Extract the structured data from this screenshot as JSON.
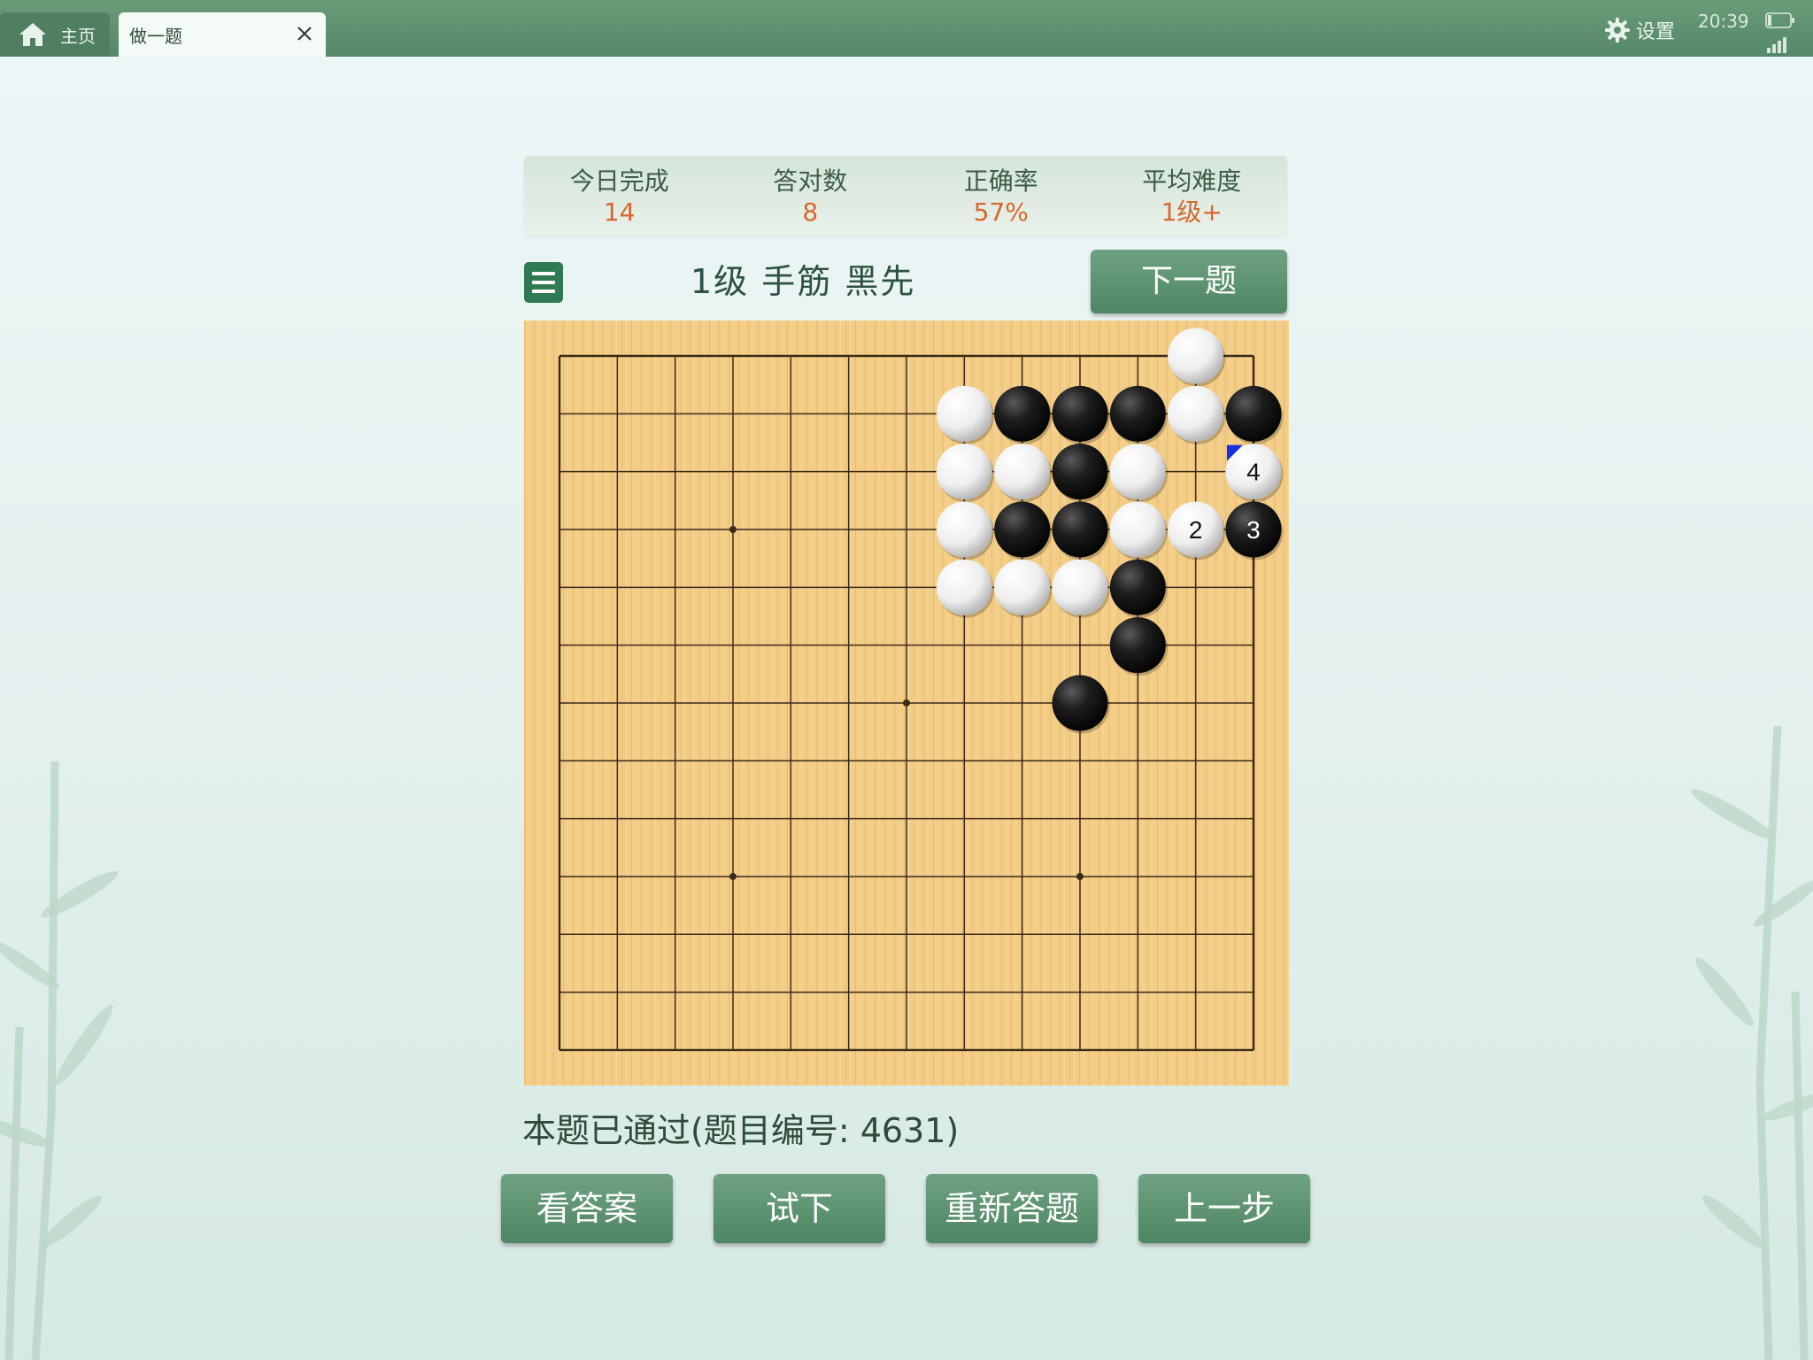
{
  "tabs": {
    "home_label": "主页",
    "active_label": "做一题"
  },
  "statusbar": {
    "settings_label": "设置",
    "time": "20:39"
  },
  "stats": [
    {
      "label": "今日完成",
      "value": "14"
    },
    {
      "label": "答对数",
      "value": "8"
    },
    {
      "label": "正确率",
      "value": "57%"
    },
    {
      "label": "平均难度",
      "value": "1级+"
    }
  ],
  "problem": {
    "title": "1级 手筋 黑先",
    "next_label": "下一题",
    "status_text": "本题已通过(题目编号: 4631)"
  },
  "actions": {
    "show_answer": "看答案",
    "try_move": "试下",
    "restart": "重新答题",
    "undo": "上一步"
  },
  "board": {
    "size": 13,
    "hoshi": [
      [
        3,
        3
      ],
      [
        9,
        3
      ],
      [
        6,
        6
      ],
      [
        3,
        9
      ],
      [
        9,
        9
      ]
    ],
    "stones": [
      {
        "col": 11,
        "row": 0,
        "color": "white"
      },
      {
        "col": 7,
        "row": 1,
        "color": "white"
      },
      {
        "col": 8,
        "row": 1,
        "color": "black"
      },
      {
        "col": 9,
        "row": 1,
        "color": "black"
      },
      {
        "col": 10,
        "row": 1,
        "color": "black"
      },
      {
        "col": 11,
        "row": 1,
        "color": "white"
      },
      {
        "col": 12,
        "row": 1,
        "color": "black"
      },
      {
        "col": 7,
        "row": 2,
        "color": "white"
      },
      {
        "col": 8,
        "row": 2,
        "color": "white"
      },
      {
        "col": 9,
        "row": 2,
        "color": "black"
      },
      {
        "col": 10,
        "row": 2,
        "color": "white"
      },
      {
        "col": 12,
        "row": 2,
        "color": "white",
        "label": "4",
        "last": true
      },
      {
        "col": 7,
        "row": 3,
        "color": "white"
      },
      {
        "col": 8,
        "row": 3,
        "color": "black"
      },
      {
        "col": 9,
        "row": 3,
        "color": "black"
      },
      {
        "col": 10,
        "row": 3,
        "color": "white"
      },
      {
        "col": 11,
        "row": 3,
        "color": "white",
        "label": "2"
      },
      {
        "col": 12,
        "row": 3,
        "color": "black",
        "label": "3"
      },
      {
        "col": 7,
        "row": 4,
        "color": "white"
      },
      {
        "col": 8,
        "row": 4,
        "color": "white"
      },
      {
        "col": 9,
        "row": 4,
        "color": "white"
      },
      {
        "col": 10,
        "row": 4,
        "color": "black"
      },
      {
        "col": 10,
        "row": 5,
        "color": "black"
      },
      {
        "col": 9,
        "row": 6,
        "color": "black"
      }
    ]
  },
  "colors": {
    "accent_green": "#4f8563",
    "stat_value": "#d8662e",
    "board_wood": "#f3cc86",
    "last_move_marker": "#1a2ee0"
  }
}
